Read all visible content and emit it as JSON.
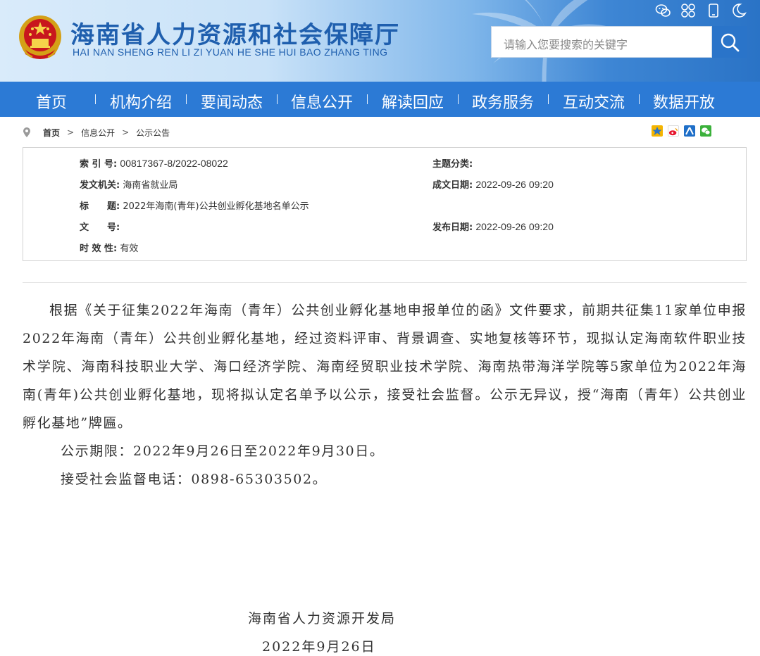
{
  "header": {
    "title": "海南省人力资源和社会保障厅",
    "subtitle": "HAI NAN SHENG REN LI ZI YUAN HE SHE HUI BAO ZHANG TING",
    "top_icons": [
      "wechat-icon",
      "grid-icon",
      "mobile-icon",
      "night-mode-icon"
    ],
    "search": {
      "placeholder": "请输入您要搜索的关键字"
    }
  },
  "nav": {
    "items": [
      {
        "label": "首页"
      },
      {
        "label": "机构介绍"
      },
      {
        "label": "要闻动态"
      },
      {
        "label": "信息公开"
      },
      {
        "label": "解读回应"
      },
      {
        "label": "政务服务"
      },
      {
        "label": "互动交流"
      },
      {
        "label": "数据开放"
      }
    ]
  },
  "breadcrumb": {
    "items": [
      "首页",
      "信息公开",
      "公示公告"
    ],
    "separator": ">"
  },
  "share_icons": [
    "qzone-icon",
    "weibo-icon",
    "renren-icon",
    "wechat-share-icon"
  ],
  "info": {
    "index_label": "索 引 号:",
    "index_value": "00817367-8/2022-08022",
    "topic_label": "主题分类:",
    "topic_value": "",
    "issuer_label": "发文机关:",
    "issuer_value": "海南省就业局",
    "date_label": "成文日期:",
    "date_value": "2022-09-26 09:20",
    "title_label": "标　　题:",
    "title_value": "2022年海南(青年)公共创业孵化基地名单公示",
    "docno_label": "文　　号:",
    "docno_value": "",
    "publish_label": "发布日期:",
    "publish_value": "2022-09-26 09:20",
    "validity_label": "时 效 性:",
    "validity_value": "有效"
  },
  "article": {
    "paragraph": "根据《关于征集2022年海南（青年）公共创业孵化基地申报单位的函》文件要求，前期共征集11家单位申报2022年海南（青年）公共创业孵化基地，经过资料评审、背景调查、实地复核等环节，现拟认定海南软件职业技术学院、海南科技职业大学、海口经济学院、海南经贸职业技术学院、海南热带海洋学院等5家单位为2022年海南(青年)公共创业孵化基地，现将拟认定名单予以公示，接受社会监督。公示无异议，授“海南（青年）公共创业孵化基地”牌匾。",
    "period": "公示期限：2022年9月26日至2022年9月30日。",
    "phone": "接受社会监督电话：0898-65303502。",
    "signature_org": "海南省人力资源开发局",
    "signature_date": "2022年9月26日"
  },
  "colors": {
    "brand_blue": "#2c7ad5",
    "title_blue": "#1f5fae",
    "search_button": "#2a74c9"
  }
}
